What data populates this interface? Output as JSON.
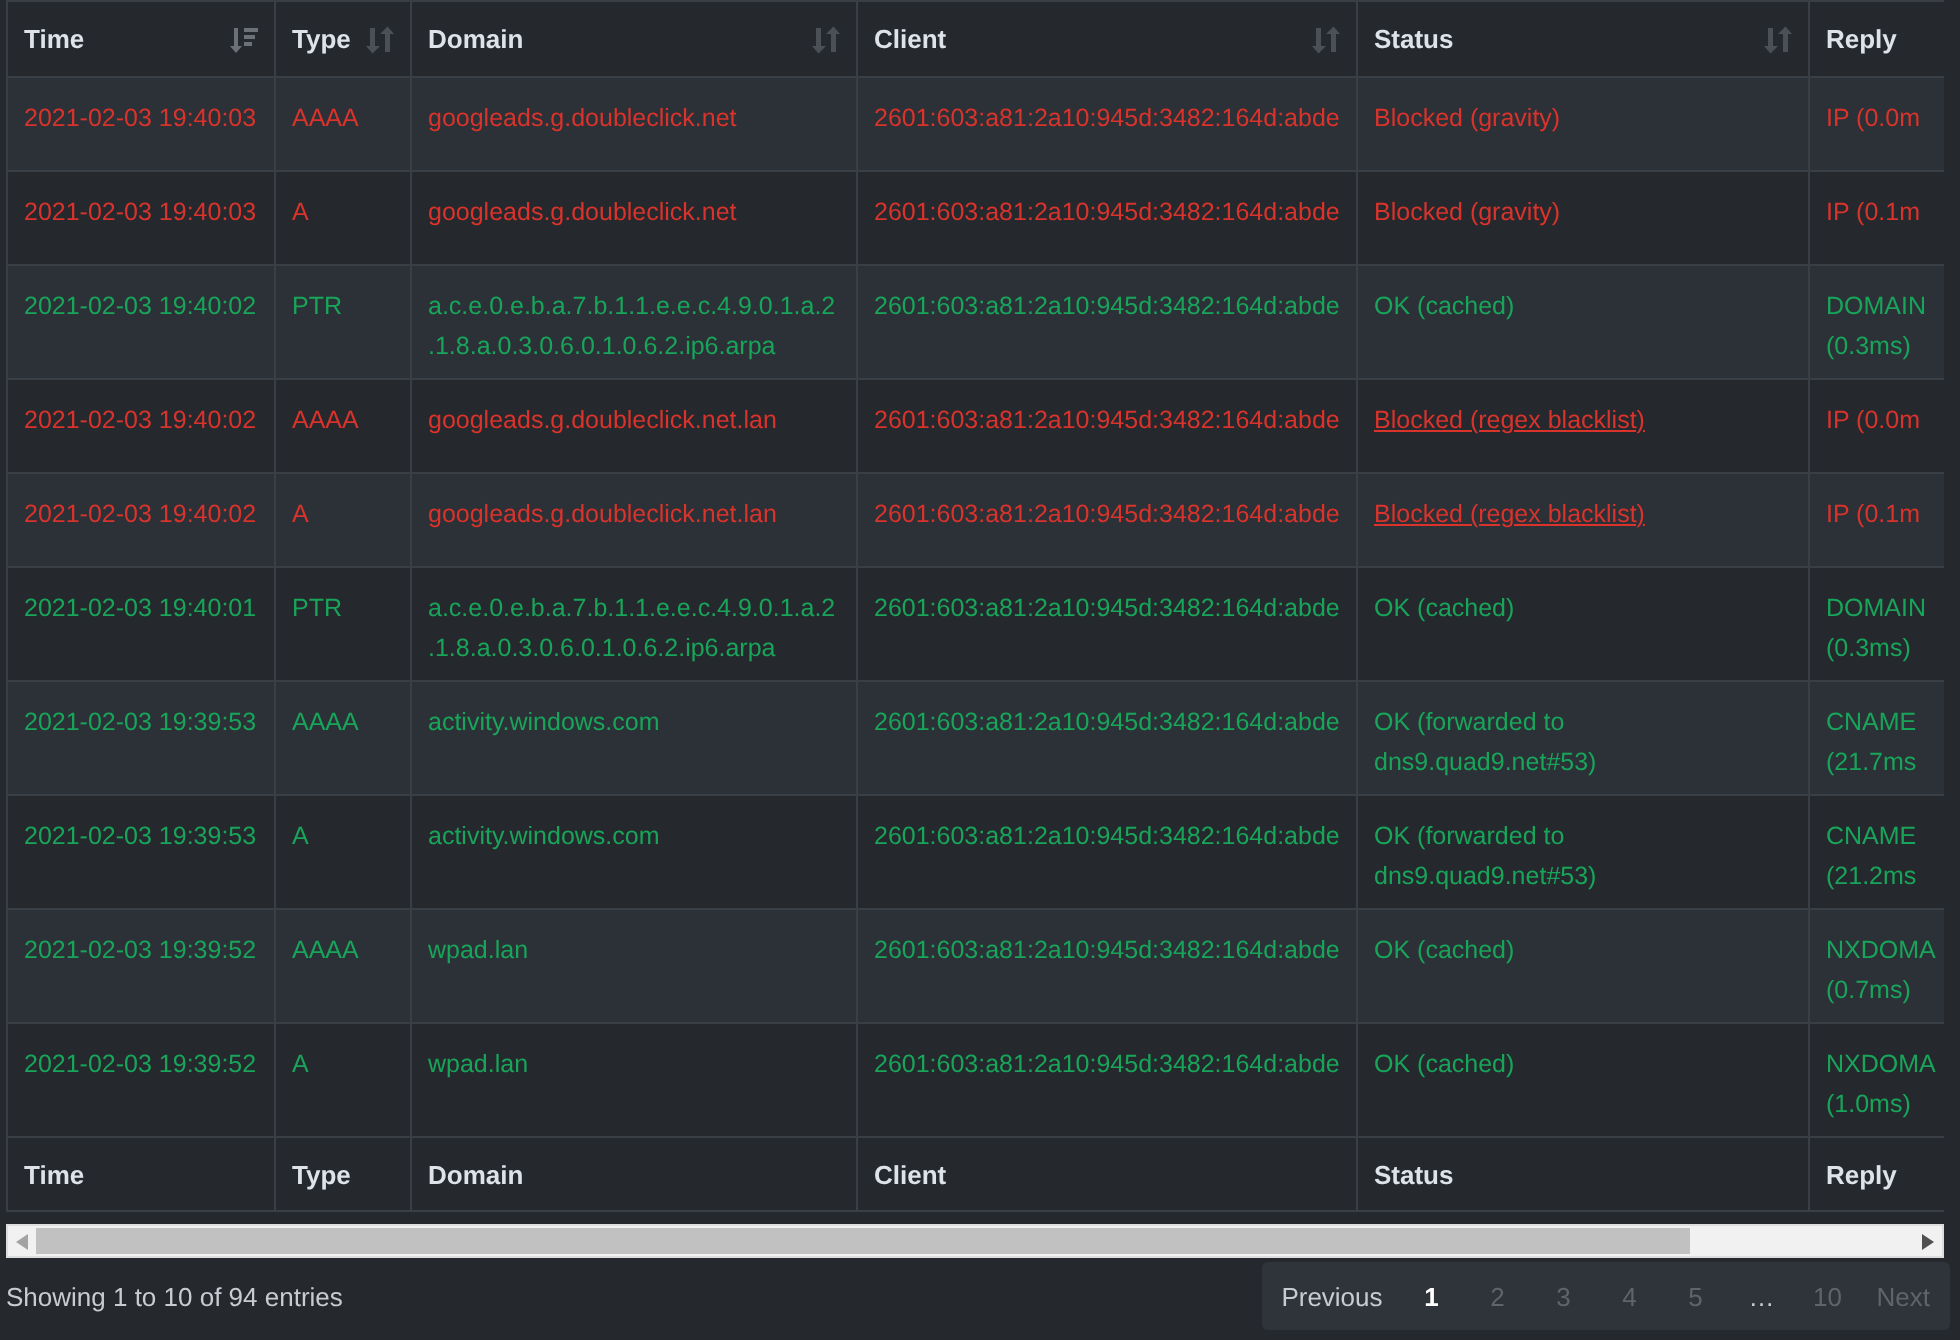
{
  "table": {
    "columns": [
      {
        "label": "Time",
        "sorted": true
      },
      {
        "label": "Type",
        "sorted": false
      },
      {
        "label": "Domain",
        "sorted": false
      },
      {
        "label": "Client",
        "sorted": false
      },
      {
        "label": "Status",
        "sorted": false
      },
      {
        "label": "Reply"
      }
    ],
    "rows": [
      {
        "blocked": true,
        "status_link": false,
        "time": "2021-02-03 19:40:03",
        "type": "AAAA",
        "domain": "googleads.g.doubleclick.net",
        "client": "2601:603:a81:2a10:945d:3482:164d:abde",
        "status": "Blocked (gravity)",
        "reply": "IP (0.0m"
      },
      {
        "blocked": true,
        "status_link": false,
        "time": "2021-02-03 19:40:03",
        "type": "A",
        "domain": "googleads.g.doubleclick.net",
        "client": "2601:603:a81:2a10:945d:3482:164d:abde",
        "status": "Blocked (gravity)",
        "reply": "IP (0.1m"
      },
      {
        "blocked": false,
        "status_link": false,
        "time": "2021-02-03 19:40:02",
        "type": "PTR",
        "domain": "a.c.e.0.e.b.a.7.b.1.1.e.e.c.4.9.0.1.a.2.1.8.a.0.3.0.6.0.1.0.6.2.ip6.arpa",
        "client": "2601:603:a81:2a10:945d:3482:164d:abde",
        "status": "OK (cached)",
        "reply": "DOMAIN (0.3ms)"
      },
      {
        "blocked": true,
        "status_link": true,
        "time": "2021-02-03 19:40:02",
        "type": "AAAA",
        "domain": "googleads.g.doubleclick.net.lan",
        "client": "2601:603:a81:2a10:945d:3482:164d:abde",
        "status": "Blocked (regex blacklist)",
        "reply": "IP (0.0m"
      },
      {
        "blocked": true,
        "status_link": true,
        "time": "2021-02-03 19:40:02",
        "type": "A",
        "domain": "googleads.g.doubleclick.net.lan",
        "client": "2601:603:a81:2a10:945d:3482:164d:abde",
        "status": "Blocked (regex blacklist)",
        "reply": "IP (0.1m"
      },
      {
        "blocked": false,
        "status_link": false,
        "time": "2021-02-03 19:40:01",
        "type": "PTR",
        "domain": "a.c.e.0.e.b.a.7.b.1.1.e.e.c.4.9.0.1.a.2.1.8.a.0.3.0.6.0.1.0.6.2.ip6.arpa",
        "client": "2601:603:a81:2a10:945d:3482:164d:abde",
        "status": "OK (cached)",
        "reply": "DOMAIN (0.3ms)"
      },
      {
        "blocked": false,
        "status_link": false,
        "time": "2021-02-03 19:39:53",
        "type": "AAAA",
        "domain": "activity.windows.com",
        "client": "2601:603:a81:2a10:945d:3482:164d:abde",
        "status": "OK (forwarded to dns9.quad9.net#53)",
        "reply": "CNAME (21.7ms"
      },
      {
        "blocked": false,
        "status_link": false,
        "time": "2021-02-03 19:39:53",
        "type": "A",
        "domain": "activity.windows.com",
        "client": "2601:603:a81:2a10:945d:3482:164d:abde",
        "status": "OK (forwarded to dns9.quad9.net#53)",
        "reply": "CNAME (21.2ms"
      },
      {
        "blocked": false,
        "status_link": false,
        "time": "2021-02-03 19:39:52",
        "type": "AAAA",
        "domain": "wpad.lan",
        "client": "2601:603:a81:2a10:945d:3482:164d:abde",
        "status": "OK (cached)",
        "reply": "NXDOMA (0.7ms)"
      },
      {
        "blocked": false,
        "status_link": false,
        "time": "2021-02-03 19:39:52",
        "type": "A",
        "domain": "wpad.lan",
        "client": "2601:603:a81:2a10:945d:3482:164d:abde",
        "status": "OK (cached)",
        "reply": "NXDOMA (1.0ms)"
      }
    ],
    "footer": [
      "Time",
      "Type",
      "Domain",
      "Client",
      "Status",
      "Reply"
    ]
  },
  "info": "Showing 1 to 10 of 94 entries",
  "pagination": [
    {
      "label": "Previous",
      "kind": "nav",
      "selected": false,
      "disabled": false
    },
    {
      "label": "1",
      "kind": "page",
      "selected": true
    },
    {
      "label": "2",
      "kind": "page",
      "selected": false
    },
    {
      "label": "3",
      "kind": "page",
      "selected": false
    },
    {
      "label": "4",
      "kind": "page",
      "selected": false
    },
    {
      "label": "5",
      "kind": "page",
      "selected": false
    },
    {
      "label": "…",
      "kind": "ellipsis",
      "selected": false
    },
    {
      "label": "10",
      "kind": "page",
      "selected": false
    },
    {
      "label": "Next",
      "kind": "nav",
      "selected": false,
      "disabled": true
    }
  ]
}
